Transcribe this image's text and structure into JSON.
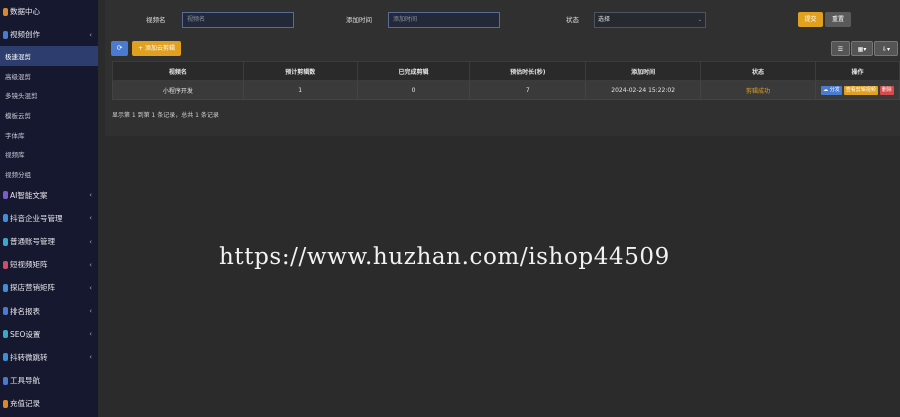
{
  "sidebar": {
    "items": [
      {
        "label": "数据中心",
        "icon": "dashboard-icon",
        "color": "#d9882a"
      },
      {
        "label": "视频创作",
        "icon": "video-icon",
        "color": "#4a7bd0",
        "caret": "‹"
      },
      {
        "label": "极速混剪",
        "sub": true,
        "active": true
      },
      {
        "label": "高级混剪",
        "sub": true
      },
      {
        "label": "多镜头混剪",
        "sub": true
      },
      {
        "label": "模板云剪",
        "sub": true
      },
      {
        "label": "字体库",
        "sub": true
      },
      {
        "label": "视频库",
        "sub": true
      },
      {
        "label": "视频分组",
        "sub": true
      },
      {
        "label": "AI智能文案",
        "icon": "ai-icon",
        "color": "#7b5cc9",
        "caret": "‹"
      },
      {
        "label": "抖音企业号管理",
        "icon": "enterprise-icon",
        "color": "#3f8fd8",
        "caret": "‹"
      },
      {
        "label": "普通账号管理",
        "icon": "account-icon",
        "color": "#3aa8c8",
        "caret": "‹"
      },
      {
        "label": "短视频矩阵",
        "icon": "matrix-icon",
        "color": "#d04a6a",
        "caret": "‹"
      },
      {
        "label": "探店营销矩阵",
        "icon": "shop-icon",
        "color": "#3f8fd8",
        "caret": "‹"
      },
      {
        "label": "排名报表",
        "icon": "report-icon",
        "color": "#4a7bd0",
        "caret": "‹"
      },
      {
        "label": "SEO设置",
        "icon": "seo-icon",
        "color": "#3aa8c8",
        "caret": "‹"
      },
      {
        "label": "抖转微跳转",
        "icon": "link-icon",
        "color": "#3f8fd8",
        "caret": "‹"
      },
      {
        "label": "工具导航",
        "icon": "tool-icon",
        "color": "#4a7bd0"
      },
      {
        "label": "充值记录",
        "icon": "recharge-icon",
        "color": "#d9882a"
      }
    ]
  },
  "search": {
    "name_label": "视频名",
    "name_placeholder": "视频名",
    "time_label": "添加时间",
    "time_placeholder": "添加时间",
    "status_label": "状态",
    "status_value": "选择",
    "submit_label": "提交",
    "reset_label": "重置"
  },
  "toolbar": {
    "refresh_icon": "⟳",
    "add_label": "+ 添加云剪辑",
    "columns_icon": "☰",
    "grid_icon": "▦▾",
    "export_icon": "⇩▾"
  },
  "table": {
    "headers": [
      "视频名",
      "预计剪辑数",
      "已完成剪辑",
      "预估时长(秒)",
      "添加时间",
      "状态",
      "操作"
    ],
    "rows": [
      {
        "cells": [
          "小程序开发",
          "1",
          "0",
          "7",
          "2024-02-24 15:22:02"
        ],
        "status": "剪辑成功",
        "actions": [
          "☁ 分发",
          "查看剪辑视频",
          "删除"
        ]
      }
    ],
    "info": "显示第 1 到第 1 条记录，总共 1 条记录"
  },
  "watermark": "https://www.huzhan.com/ishop44509",
  "colors": {
    "sidebar_bg": "#16182f",
    "active_item": "#2c3d6e",
    "primary": "#4a7bd0",
    "warning": "#e0a020",
    "danger": "#d94a4a",
    "status_success": "#e0a020"
  }
}
